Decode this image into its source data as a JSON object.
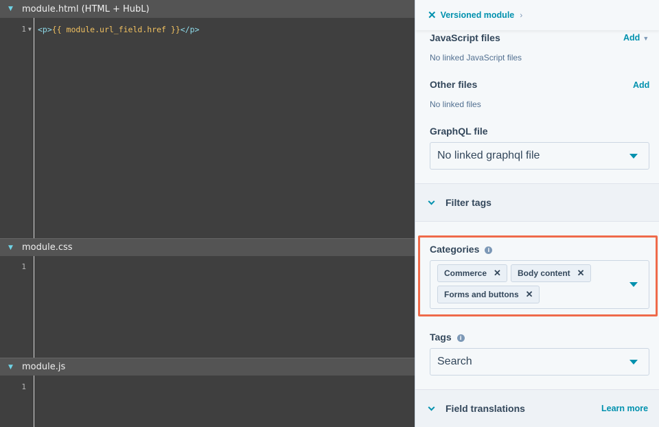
{
  "editor": {
    "html_pane": {
      "title": "module.html (HTML + HubL)",
      "lines": [
        {
          "number": "1",
          "code_tag_open": "<p>",
          "code_hubl": "{{ module.url_field.href }}",
          "code_tag_close": "</p>"
        }
      ]
    },
    "css_pane": {
      "title": "module.css",
      "line_number": "1"
    },
    "js_pane": {
      "title": "module.js",
      "line_number": "1"
    }
  },
  "sidebar": {
    "topbar": {
      "icon": "close-x-icon",
      "label": "Versioned module"
    },
    "javascript_files": {
      "title": "JavaScript files",
      "add_label": "Add",
      "empty_text": "No linked JavaScript files"
    },
    "other_files": {
      "title": "Other files",
      "add_label": "Add",
      "empty_text": "No linked files"
    },
    "graphql_file": {
      "title": "GraphQL file",
      "select_value": "No linked graphql file"
    },
    "filter_tags": {
      "title": "Filter tags"
    },
    "categories": {
      "title": "Categories",
      "chips": [
        "Commerce",
        "Body content",
        "Forms and buttons"
      ]
    },
    "tags": {
      "title": "Tags",
      "placeholder": "Search"
    },
    "field_translations": {
      "title": "Field translations",
      "learn_more": "Learn more"
    }
  },
  "colors": {
    "accent": "#0091ae",
    "highlight": "#ef6a4a",
    "editor_bg": "#3f3f3f",
    "pane_header_bg": "#545454",
    "hubl_text": "#f0c060",
    "tag_text": "#8fdceb"
  }
}
